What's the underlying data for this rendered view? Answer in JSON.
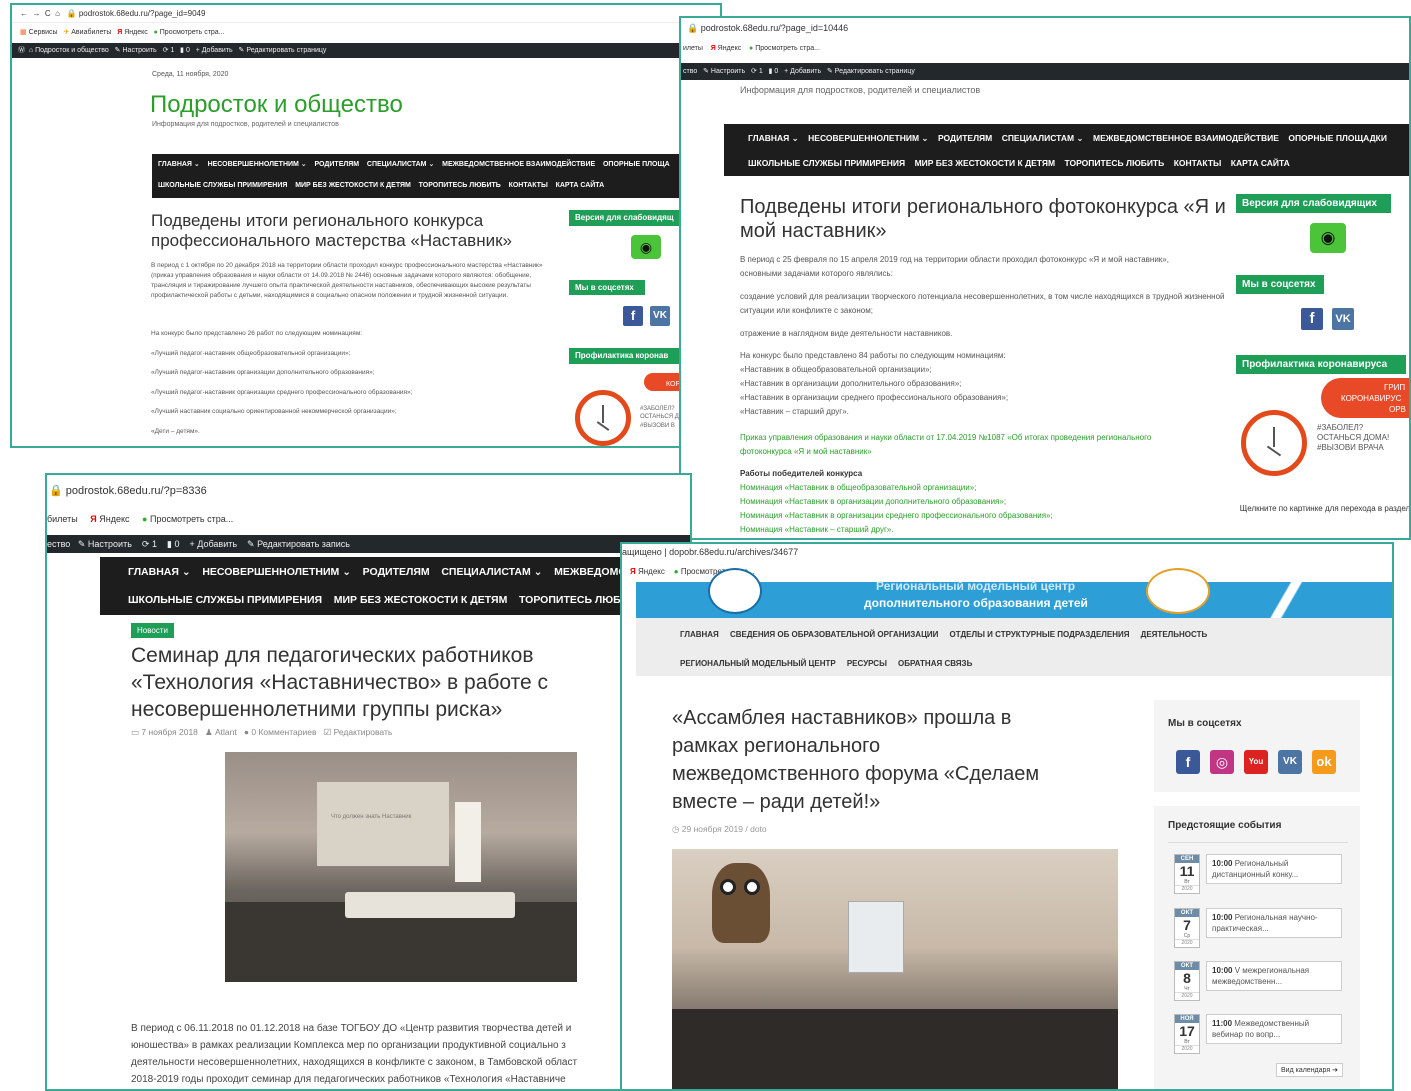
{
  "s1": {
    "url": "podrostok.68edu.ru/?page_id=9049",
    "bookmarks": [
      "Сервисы",
      "Авиабилеты",
      "Яндекс",
      "Просмотреть стра..."
    ],
    "admin": [
      "Подросток и общество",
      "Настроить",
      "1",
      "0",
      "+ Добавить",
      "Редактировать страницу"
    ],
    "date": "Среда, 11 ноября, 2020",
    "site_title": "Подросток и общество",
    "tagline": "Информация для подростков, родителей и специалистов",
    "nav1": [
      "ГЛАВНАЯ ⌄",
      "НЕСОВЕРШЕННОЛЕТНИМ ⌄",
      "РОДИТЕЛЯМ",
      "СПЕЦИАЛИСТАМ ⌄",
      "МЕЖВЕДОМСТВЕННОЕ ВЗАИМОДЕЙСТВИЕ",
      "ОПОРНЫЕ ПЛОЩА"
    ],
    "nav2": [
      "ШКОЛЬНЫЕ СЛУЖБЫ ПРИМИРЕНИЯ",
      "МИР БЕЗ ЖЕСТОКОСТИ К ДЕТЯМ",
      "ТОРОПИТЕСЬ ЛЮБИТЬ",
      "КОНТАКТЫ",
      "КАРТА САЙТА"
    ],
    "heading": "Подведены итоги регионального конкурса профессионального мастерства «Наставник»",
    "para": "В период с 1 октября по 20 декабря 2018 на территории области проходил конкурс профессионального мастерства «Наставник» (приказ управления образования и науки области от 14.09.2018 № 2446) основные задачами которого являются: обобщение, трансляция и тиражирование лучшего опыта практической деятельности наставников, обеспечивающих высокие результаты профилактической работы с детьми, находящимися в социально опасном положении и трудной жизненной ситуации.",
    "lines": [
      "На конкурс было представлено 26 работ по следующим номинациям:",
      "«Лучший педагог-наставник общеобразовательной организации»;",
      "«Лучший педагог-наставник организации дополнительного образования»;",
      "«Лучший педагог-наставник организации среднего профессионального образования»;",
      "«Лучший наставник социально ориентированной некоммерческой организации»;",
      "«Дети – детям»."
    ],
    "widget_vision": "Версия для слабовидящ",
    "widget_social": "Мы в соцсетях",
    "widget_covid": "Профилактика коронав",
    "banner_text": [
      "КОР",
      "#ЗАБОЛЕЛ?",
      "ОСТАНЬСЯ Д",
      "#ВЫЗОВИ В"
    ]
  },
  "s2": {
    "url": "podrostok.68edu.ru/?page_id=10446",
    "bookmarks": [
      "илеты",
      "Яндекс",
      "Просмотреть стра..."
    ],
    "admin": [
      "ство",
      "Настроить",
      "1",
      "0",
      "+ Добавить",
      "Редактировать страницу"
    ],
    "tagline": "Информация для подростков, родителей и специалистов",
    "nav1": [
      "ГЛАВНАЯ ⌄",
      "НЕСОВЕРШЕННОЛЕТНИМ ⌄",
      "РОДИТЕЛЯМ",
      "СПЕЦИАЛИСТАМ ⌄",
      "МЕЖВЕДОМСТВЕННОЕ ВЗАИМОДЕЙСТВИЕ",
      "ОПОРНЫЕ ПЛОЩАДКИ"
    ],
    "nav2": [
      "ШКОЛЬНЫЕ СЛУЖБЫ ПРИМИРЕНИЯ",
      "МИР БЕЗ ЖЕСТОКОСТИ К ДЕТЯМ",
      "ТОРОПИТЕСЬ ЛЮБИТЬ",
      "КОНТАКТЫ",
      "КАРТА САЙТА"
    ],
    "heading": "Подведены итоги регионального фотоконкурса «Я и мой наставник»",
    "para1": "В период с 25 февраля по 15 апреля 2019 год на территории области проходил фотоконкурс «Я и мой наставник», основными задачами которого являлись:",
    "para2": "создание условий для реализации творческого потенциала несовершеннолетних, в том числе находящихся в трудной жизненной ситуации или конфликте с законом;",
    "para3": "отражение в наглядном виде деятельности наставников.",
    "lines": [
      "На конкурс было представлено 84 работы по следующим номинациям:",
      "«Наставник в общеобразовательной организации»;",
      "«Наставник в организации дополнительного образования»;",
      "«Наставник в организации среднего профессионального образования»;",
      "«Наставник – старший друг»."
    ],
    "order_link": "Приказ управления образования и науки области от 17.04.2019 №1087 «Об итогах проведения регионального фотоконкурса «Я и мой наставник»",
    "winners_title": "Работы победителей конкурса",
    "winners": [
      "Номинация «Наставник в общеобразовательной организации»;",
      "Номинация «Наставник в организации дополнительного образования»;",
      "Номинация «Наставник в организации среднего профессионального образования»;",
      "Номинация «Наставник – старший друг»."
    ],
    "widget_vision": "Версия для слабовидящих",
    "widget_social": "Мы в соцсетях",
    "widget_covid": "Профилактика коронавируса",
    "banner_text": [
      "ГРИП",
      "КОРОНАВИРУС",
      "ОРВ",
      "#ЗАБОЛЕЛ?",
      "ОСТАНЬСЯ ДОМА!",
      "#ВЫЗОВИ ВРАЧА"
    ],
    "banner_caption": "Щелкните по картинке для перехода в раздел"
  },
  "s3": {
    "url": "podrostok.68edu.ru/?p=8336",
    "bookmarks": [
      "билеты",
      "Яндекс",
      "Просмотреть стра..."
    ],
    "admin": [
      "ество",
      "Настроить",
      "1",
      "0",
      "+ Добавить",
      "Редактировать запись"
    ],
    "nav1": [
      "ГЛАВНАЯ ⌄",
      "НЕСОВЕРШЕННОЛЕТНИМ ⌄",
      "РОДИТЕЛЯМ",
      "СПЕЦИАЛИСТАМ ⌄",
      "МЕЖВЕДОМСТВ"
    ],
    "nav2": [
      "ШКОЛЬНЫЕ СЛУЖБЫ ПРИМИРЕНИЯ",
      "МИР БЕЗ ЖЕСТОКОСТИ К ДЕТЯМ",
      "ТОРОПИТЕСЬ ЛЮБИТЬ"
    ],
    "tag": "Новости",
    "heading": "Семинар для педагогических работников «Технология «Наставничество» в работе с несовершеннолетними группы риска»",
    "meta": [
      "7 ноября 2018",
      "Atlant",
      "0 Комментариев",
      "Редактировать"
    ],
    "slide_text": "Что должен знать Наставник",
    "para": [
      "В период с 06.11.2018 по 01.12.2018 на базе ТОГБОУ ДО «Центр развития творчества детей и",
      "юношества» в рамках реализации Комплекса мер по организации продуктивной социально з",
      "деятельности несовершеннолетних, находящихся в конфликте с законом, в Тамбовской област",
      "2018-2019 годы проходит семинар для педагогических работников «Технология «Наставниче"
    ]
  },
  "s4": {
    "url_prefix": "ащищено",
    "url": "dopobr.68edu.ru/archives/34677",
    "bookmarks": [
      "Яндекс",
      "Просмотреть стра..."
    ],
    "header_line1": "Региональный модельный центр",
    "header_line2": "дополнительного образования детей",
    "nav1": [
      "ГЛАВНАЯ",
      "СВЕДЕНИЯ ОБ ОБРАЗОВАТЕЛЬНОЙ ОРГАНИЗАЦИИ",
      "ОТДЕЛЫ И СТРУКТУРНЫЕ ПОДРАЗДЕЛЕНИЯ",
      "ДЕЯТЕЛЬНОСТЬ"
    ],
    "nav2": [
      "РЕГИОНАЛЬНЫЙ МОДЕЛЬНЫЙ ЦЕНТР",
      "РЕСУРСЫ",
      "ОБРАТНАЯ СВЯЗЬ"
    ],
    "heading": "«Ассамблея наставников» прошла в рамках регионального межведомственного форума «Сделаем вместе – ради детей!»",
    "meta": "29 ноября 2019 / doto",
    "social_title": "Мы в соцсетях",
    "events_title": "Предстоящие события",
    "events": [
      {
        "month": "СЕН",
        "day": "11",
        "wd": "Вт",
        "year": "2020",
        "time": "10:00",
        "text": "Региональный дистанционный конку..."
      },
      {
        "month": "ОКТ",
        "day": "7",
        "wd": "Ср",
        "year": "2020",
        "time": "10:00",
        "text": "Региональная научно-практическая..."
      },
      {
        "month": "ОКТ",
        "day": "8",
        "wd": "Чт",
        "year": "2020",
        "time": "10:00",
        "text": "V межрегиональная межведомственн..."
      },
      {
        "month": "НОЯ",
        "day": "17",
        "wd": "Вт",
        "year": "2020",
        "time": "11:00",
        "text": "Межведомственный вебинар по вопр..."
      }
    ],
    "calendar_link": "Вид календаря ➔"
  },
  "colors": {
    "accent": "#3aaa98",
    "green": "#1f9e58",
    "dark": "#1d1d1d",
    "admin": "#23282d",
    "title_green": "#2a9d2a",
    "vk": "#4c75a3",
    "fb": "#3b5998"
  }
}
